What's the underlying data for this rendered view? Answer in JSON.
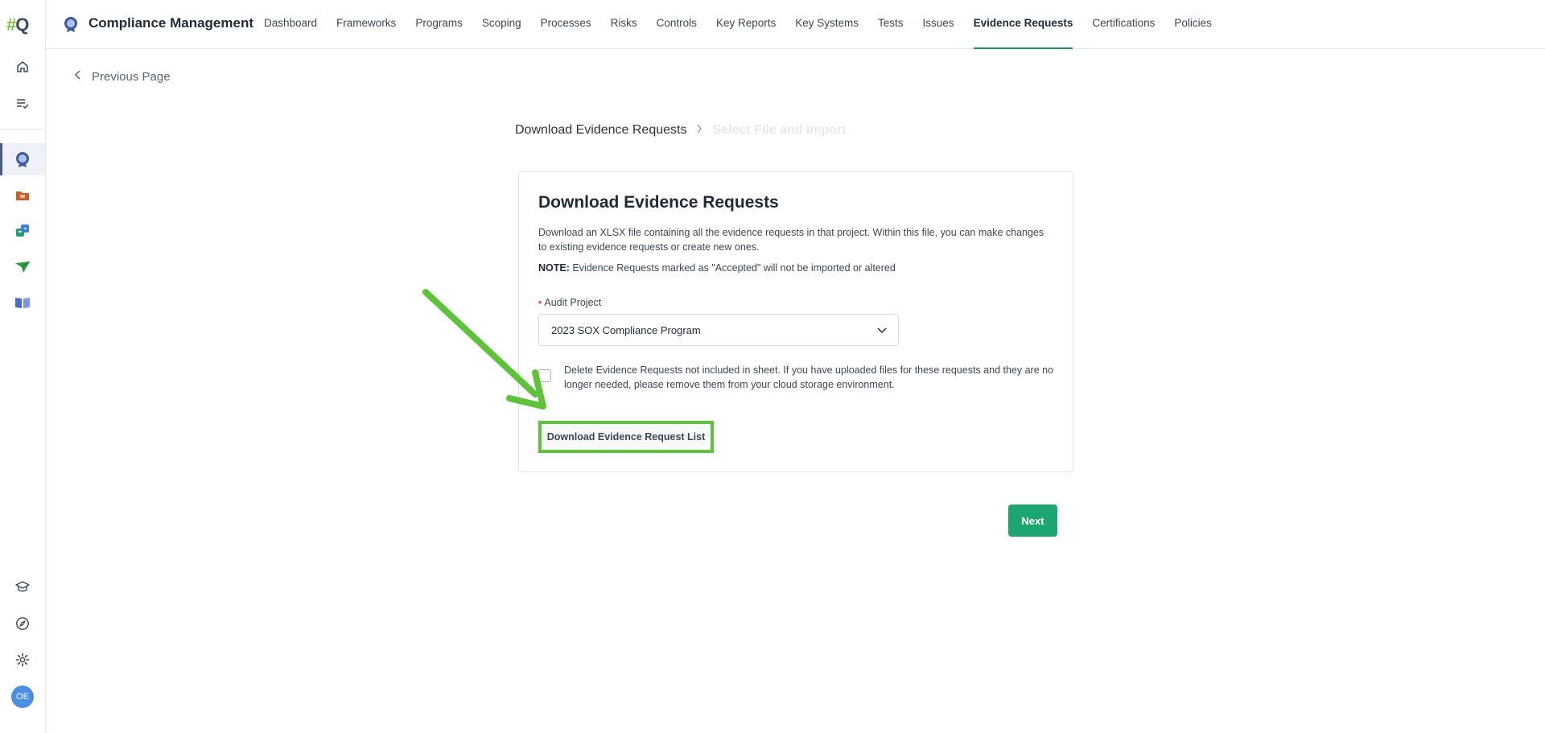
{
  "logo": {
    "hash": "#",
    "q": "Q"
  },
  "header": {
    "app_title": "Compliance Management",
    "nav": [
      {
        "label": "Dashboard"
      },
      {
        "label": "Frameworks"
      },
      {
        "label": "Programs"
      },
      {
        "label": "Scoping"
      },
      {
        "label": "Processes"
      },
      {
        "label": "Risks"
      },
      {
        "label": "Controls"
      },
      {
        "label": "Key Reports"
      },
      {
        "label": "Key Systems"
      },
      {
        "label": "Tests"
      },
      {
        "label": "Issues"
      },
      {
        "label": "Evidence Requests",
        "active": true
      },
      {
        "label": "Certifications"
      },
      {
        "label": "Policies"
      }
    ]
  },
  "sidebar": {
    "icons": [
      "home-icon",
      "tasks-icon",
      "compliance-icon",
      "folder-icon",
      "sync-icon",
      "send-icon",
      "book-icon",
      "academy-icon",
      "compass-icon",
      "settings-icon"
    ],
    "avatar": "OE"
  },
  "back": {
    "label": "Previous Page"
  },
  "steps": {
    "step1": "Download Evidence Requests",
    "step2": "Select File and Import"
  },
  "card": {
    "title": "Download Evidence Requests",
    "description": "Download an XLSX file containing all the evidence requests in that project. Within this file, you can make changes to existing evidence requests or create new ones.",
    "note_label": "NOTE:",
    "note_text": " Evidence Requests marked as \"Accepted\" will not be imported or altered",
    "field_label": "Audit Project",
    "required_mark": "•",
    "selected_project": "2023 SOX Compliance Program",
    "checkbox_label": "Delete Evidence Requests not included in sheet. If you have uploaded files for these requests and they are no longer needed, please remove them from your cloud storage environment.",
    "checkbox_checked": false,
    "download_button": "Download Evidence Request List"
  },
  "next_button": "Next",
  "colors": {
    "accent": "#1ea672",
    "highlight": "#5ec23a",
    "nav_underline": "#1e8c6b"
  }
}
